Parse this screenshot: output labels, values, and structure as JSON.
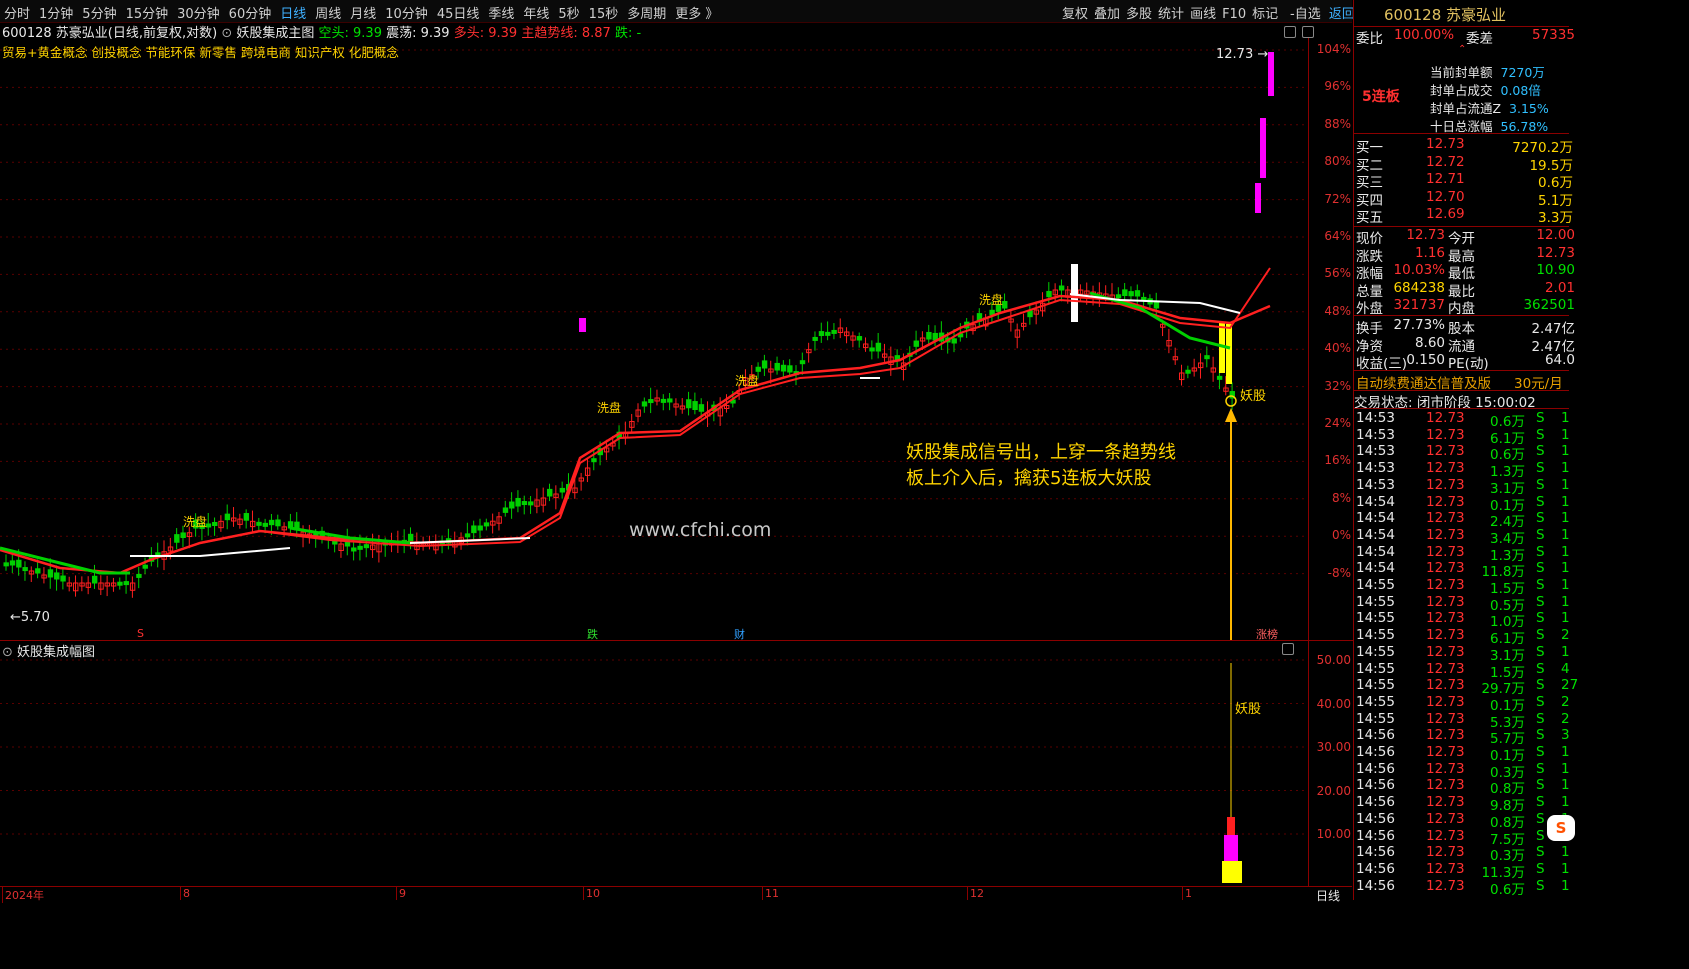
{
  "toolbar": {
    "periods": [
      "分时",
      "1分钟",
      "5分钟",
      "15分钟",
      "30分钟",
      "60分钟",
      "日线",
      "周线",
      "月线",
      "10分钟",
      "45日线",
      "季线",
      "年线",
      "5秒",
      "15秒",
      "多周期",
      "更多 》"
    ],
    "active_period": "日线",
    "right_tools": [
      "复权",
      "叠加",
      "多股",
      "统计",
      "画线",
      "F10",
      "标记"
    ],
    "watch": "-自选",
    "back": "返回"
  },
  "stock_line": {
    "title": "600128 苏豪弘业(日线,前复权,对数)",
    "indicator": "妖股集成主图",
    "kong": "空头: 9.39",
    "zhen": "震荡: 9.39",
    "duo": "多头: 9.39",
    "trend": "主趋势线: 8.87",
    "die": "跌: -"
  },
  "concepts": "贸易+黄金概念 创投概念 节能环保 新零售 跨境电商 知识产权 化肥概念",
  "main_labels": {
    "high": "12.73",
    "low": "5.70",
    "xipan": "洗盘",
    "yaogu": "妖股",
    "annotation_line1": "妖股集成信号出，上穿一条趋势线",
    "annotation_line2": "板上介入后，擒获5连板大妖股",
    "watermark": "www.cfchi.com",
    "event_s": "S",
    "event_die": "跌",
    "event_cai": "财",
    "event_zt": "涨榜"
  },
  "pct_axis": [
    "104%",
    "96%",
    "88%",
    "80%",
    "72%",
    "64%",
    "56%",
    "48%",
    "40%",
    "32%",
    "24%",
    "16%",
    "8%",
    "0%",
    "-8%"
  ],
  "sub": {
    "title": "妖股集成幅图",
    "axis": [
      "50.00",
      "40.00",
      "30.00",
      "20.00",
      "10.00"
    ],
    "label": "妖股"
  },
  "x_axis": [
    "2024年",
    "8",
    "9",
    "10",
    "11",
    "12",
    "1"
  ],
  "x_axis_mode": "日线",
  "panel": {
    "code": "600128",
    "name": "苏豪弘业",
    "weibi_label": "委比",
    "weibi": "100.00%",
    "weicha_label": "委差",
    "weicha": "57335",
    "lianban": "5连板",
    "seal": [
      {
        "k": "当前封单额",
        "v": "7270万"
      },
      {
        "k": "封单占成交",
        "v": "0.08倍"
      },
      {
        "k": "封单占流通Z",
        "v": "3.15%"
      },
      {
        "k": "十日总涨幅",
        "v": "56.78%"
      }
    ],
    "buys": [
      {
        "k": "买一",
        "p": "12.73",
        "v": "7270.2万"
      },
      {
        "k": "买二",
        "p": "12.72",
        "v": "19.5万"
      },
      {
        "k": "买三",
        "p": "12.71",
        "v": "0.6万"
      },
      {
        "k": "买四",
        "p": "12.70",
        "v": "5.1万"
      },
      {
        "k": "买五",
        "p": "12.69",
        "v": "3.3万"
      }
    ],
    "quote": [
      {
        "k1": "现价",
        "v1": "12.73",
        "k2": "今开",
        "v2": "12.00"
      },
      {
        "k1": "涨跌",
        "v1": "1.16",
        "k2": "最高",
        "v2": "12.73"
      },
      {
        "k1": "涨幅",
        "v1": "10.03%",
        "k2": "最低",
        "v2": "10.90"
      },
      {
        "k1": "总量",
        "v1": "684238",
        "k2": "最比",
        "v2": "2.01"
      },
      {
        "k1": "外盘",
        "v1": "321737",
        "k2": "内盘",
        "v2": "362501"
      }
    ],
    "fund": [
      {
        "k1": "换手",
        "v1": "27.73%",
        "k2": "股本",
        "v2": "2.47亿"
      },
      {
        "k1": "净资",
        "v1": "8.60",
        "k2": "流通",
        "v2": "2.47亿"
      },
      {
        "k1": "收益(三)",
        "v1": "0.150",
        "k2": "PE(动)",
        "v2": "64.0"
      }
    ],
    "ad": "自动续费通达信普及版",
    "ad_price": "30元/月",
    "status": "交易状态: 闭市阶段 15:00:02",
    "ticks": [
      {
        "t": "14:53",
        "p": "12.73",
        "v": "0.6万",
        "s": "S",
        "n": "1"
      },
      {
        "t": "14:53",
        "p": "12.73",
        "v": "6.1万",
        "s": "S",
        "n": "1"
      },
      {
        "t": "14:53",
        "p": "12.73",
        "v": "0.6万",
        "s": "S",
        "n": "1"
      },
      {
        "t": "14:53",
        "p": "12.73",
        "v": "1.3万",
        "s": "S",
        "n": "1"
      },
      {
        "t": "14:53",
        "p": "12.73",
        "v": "3.1万",
        "s": "S",
        "n": "1"
      },
      {
        "t": "14:54",
        "p": "12.73",
        "v": "0.1万",
        "s": "S",
        "n": "1"
      },
      {
        "t": "14:54",
        "p": "12.73",
        "v": "2.4万",
        "s": "S",
        "n": "1"
      },
      {
        "t": "14:54",
        "p": "12.73",
        "v": "3.4万",
        "s": "S",
        "n": "1"
      },
      {
        "t": "14:54",
        "p": "12.73",
        "v": "1.3万",
        "s": "S",
        "n": "1"
      },
      {
        "t": "14:54",
        "p": "12.73",
        "v": "11.8万",
        "s": "S",
        "n": "1"
      },
      {
        "t": "14:55",
        "p": "12.73",
        "v": "1.5万",
        "s": "S",
        "n": "1"
      },
      {
        "t": "14:55",
        "p": "12.73",
        "v": "0.5万",
        "s": "S",
        "n": "1"
      },
      {
        "t": "14:55",
        "p": "12.73",
        "v": "1.0万",
        "s": "S",
        "n": "1"
      },
      {
        "t": "14:55",
        "p": "12.73",
        "v": "6.1万",
        "s": "S",
        "n": "2"
      },
      {
        "t": "14:55",
        "p": "12.73",
        "v": "3.1万",
        "s": "S",
        "n": "1"
      },
      {
        "t": "14:55",
        "p": "12.73",
        "v": "1.5万",
        "s": "S",
        "n": "4"
      },
      {
        "t": "14:55",
        "p": "12.73",
        "v": "29.7万",
        "s": "S",
        "n": "27"
      },
      {
        "t": "14:55",
        "p": "12.73",
        "v": "0.1万",
        "s": "S",
        "n": "2"
      },
      {
        "t": "14:55",
        "p": "12.73",
        "v": "5.3万",
        "s": "S",
        "n": "2"
      },
      {
        "t": "14:56",
        "p": "12.73",
        "v": "5.7万",
        "s": "S",
        "n": "3"
      },
      {
        "t": "14:56",
        "p": "12.73",
        "v": "0.1万",
        "s": "S",
        "n": "1"
      },
      {
        "t": "14:56",
        "p": "12.73",
        "v": "0.3万",
        "s": "S",
        "n": "1"
      },
      {
        "t": "14:56",
        "p": "12.73",
        "v": "0.8万",
        "s": "S",
        "n": "1"
      },
      {
        "t": "14:56",
        "p": "12.73",
        "v": "9.8万",
        "s": "S",
        "n": "1"
      },
      {
        "t": "14:56",
        "p": "12.73",
        "v": "0.8万",
        "s": "S",
        "n": "1"
      },
      {
        "t": "14:56",
        "p": "12.73",
        "v": "7.5万",
        "s": "S",
        "n": "1"
      },
      {
        "t": "14:56",
        "p": "12.73",
        "v": "0.3万",
        "s": "S",
        "n": "1"
      },
      {
        "t": "14:56",
        "p": "12.73",
        "v": "11.3万",
        "s": "S",
        "n": "1"
      },
      {
        "t": "14:56",
        "p": "12.73",
        "v": "0.6万",
        "s": "S",
        "n": "1"
      }
    ]
  },
  "colors": {
    "up": "#ff2020",
    "down": "#00d000",
    "axis": "#8b0000",
    "accent": "#ffd400",
    "limit": "#ff00ff"
  }
}
